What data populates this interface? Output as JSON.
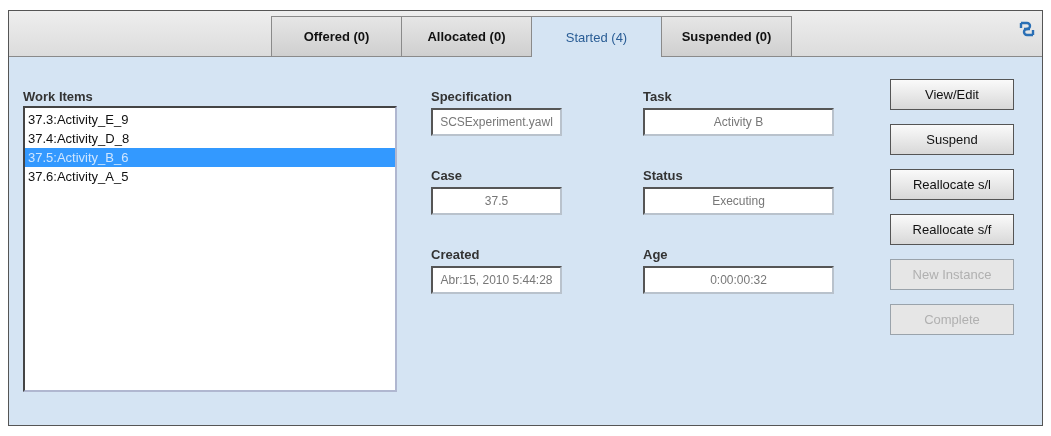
{
  "tabs": [
    {
      "label": "Offered (0)",
      "selected": false
    },
    {
      "label": "Allocated (0)",
      "selected": false
    },
    {
      "label": "Started (4)",
      "selected": true
    },
    {
      "label": "Suspended (0)",
      "selected": false
    }
  ],
  "work_items": {
    "label": "Work Items",
    "items": [
      {
        "text": "37.3:Activity_E_9",
        "selected": false
      },
      {
        "text": "37.4:Activity_D_8",
        "selected": false
      },
      {
        "text": "37.5:Activity_B_6",
        "selected": true
      },
      {
        "text": "37.6:Activity_A_5",
        "selected": false
      }
    ]
  },
  "fields": [
    {
      "label": "Specification",
      "value": "SCSExperiment.yawl"
    },
    {
      "label": "Task",
      "value": "Activity B"
    },
    {
      "label": "Case",
      "value": "37.5"
    },
    {
      "label": "Status",
      "value": "Executing"
    },
    {
      "label": "Created",
      "value": "Abr:15, 2010 5:44:28"
    },
    {
      "label": "Age",
      "value": "0:00:00:32"
    }
  ],
  "buttons": [
    {
      "label": "View/Edit",
      "disabled": false
    },
    {
      "label": "Suspend",
      "disabled": false
    },
    {
      "label": "Reallocate s/l",
      "disabled": false
    },
    {
      "label": "Reallocate s/f",
      "disabled": false
    },
    {
      "label": "New Instance",
      "disabled": true
    },
    {
      "label": "Complete",
      "disabled": true
    }
  ]
}
